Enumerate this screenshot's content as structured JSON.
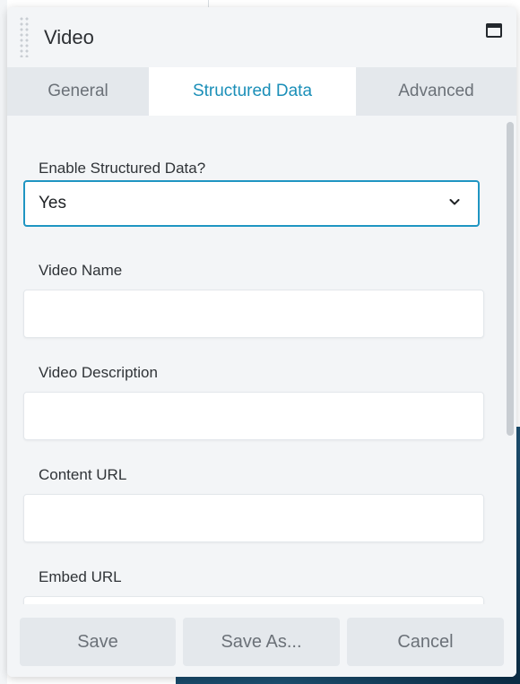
{
  "panel": {
    "title": "Video"
  },
  "tabs": [
    {
      "label": "General",
      "active": false
    },
    {
      "label": "Structured Data",
      "active": true
    },
    {
      "label": "Advanced",
      "active": false
    }
  ],
  "form": {
    "enable_label": "Enable Structured Data?",
    "enable_value": "Yes",
    "fields": [
      {
        "label": "Video Name",
        "value": ""
      },
      {
        "label": "Video Description",
        "value": ""
      },
      {
        "label": "Content URL",
        "value": ""
      },
      {
        "label": "Embed URL",
        "value": ""
      }
    ]
  },
  "footer": {
    "save_label": "Save",
    "save_as_label": "Save As...",
    "cancel_label": "Cancel"
  },
  "colors": {
    "accent": "#1f95c2",
    "active_tab_text": "#1b8fb8",
    "panel_bg": "#f3f5f7",
    "button_bg": "#e4e8ec"
  },
  "icons": {
    "maximize": "maximize-icon",
    "dropdown": "chevron-down-icon",
    "drag": "drag-handle-icon"
  }
}
